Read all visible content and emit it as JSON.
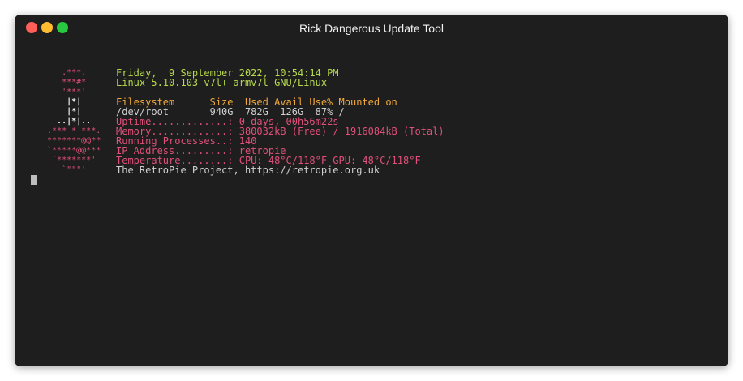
{
  "window": {
    "title": "Rick Dangerous Update Tool"
  },
  "logo_art": [
    "    .***.    ",
    "    ***#*    ",
    "    '***'    ",
    "     |*|     ",
    "     |*|     ",
    "   ..|*|..   ",
    " .*** * ***. ",
    " *******@@** ",
    " `*****@@*** ",
    "  `*******'  ",
    "    `\"\"\"'    "
  ],
  "terminal": {
    "datetime": "Friday,  9 September 2022, 10:54:14 PM",
    "kernel": "Linux 5.10.103-v7l+ armv7l GNU/Linux",
    "fs_header": "Filesystem      Size  Used Avail Use% Mounted on",
    "fs_row": "/dev/root       940G  782G  126G  87% /",
    "uptime": "Uptime.............: 0 days, 00h56m22s",
    "memory": "Memory.............: 380032kB (Free) / 1916084kB (Total)",
    "processes": "Running Processes..: 140",
    "ip": "IP Address.........: retropie",
    "temperature": "Temperature........: CPU: 48°C/118°F GPU: 48°C/118°F",
    "footer": "The RetroPie Project, https://retropie.org.uk"
  },
  "colors": {
    "background": "#1e1e1e",
    "green": "#b6d94c",
    "orange": "#f2a83c",
    "pink": "#e0507a",
    "grey": "#cfcfcf"
  }
}
